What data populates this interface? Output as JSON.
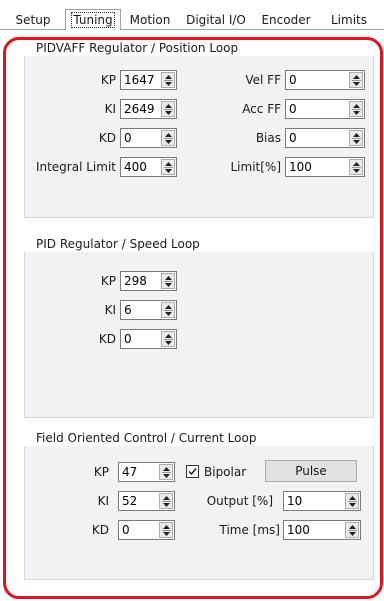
{
  "tabs": [
    {
      "label": "Setup"
    },
    {
      "label": "Tuning"
    },
    {
      "label": "Motion"
    },
    {
      "label": "Digital I/O"
    },
    {
      "label": "Encoder"
    },
    {
      "label": "Limits"
    }
  ],
  "active_tab": "Tuning",
  "position_loop": {
    "title": "PIDVAFF Regulator / Position Loop",
    "kp": {
      "label": "KP",
      "value": "1647"
    },
    "ki": {
      "label": "KI",
      "value": "2649"
    },
    "kd": {
      "label": "KD",
      "value": "0"
    },
    "integral_limit": {
      "label": "Integral Limit",
      "value": "400"
    },
    "vel_ff": {
      "label": "Vel FF",
      "value": "0"
    },
    "acc_ff": {
      "label": "Acc FF",
      "value": "0"
    },
    "bias": {
      "label": "Bias",
      "value": "0"
    },
    "limit": {
      "label": "Limit[%]",
      "value": "100"
    }
  },
  "speed_loop": {
    "title": "PID Regulator / Speed Loop",
    "kp": {
      "label": "KP",
      "value": "298"
    },
    "ki": {
      "label": "KI",
      "value": "6"
    },
    "kd": {
      "label": "KD",
      "value": "0"
    }
  },
  "current_loop": {
    "title": "Field Oriented Control / Current Loop",
    "kp": {
      "label": "KP",
      "value": "47"
    },
    "ki": {
      "label": "KI",
      "value": "52"
    },
    "kd": {
      "label": "KD",
      "value": "0"
    },
    "bipolar": {
      "label": "Bipolar",
      "checked": true
    },
    "pulse_button": "Pulse",
    "output": {
      "label": "Output [%]",
      "value": "10"
    },
    "time": {
      "label": "Time [ms]",
      "value": "100"
    }
  },
  "highlight_color": "#e0141c"
}
